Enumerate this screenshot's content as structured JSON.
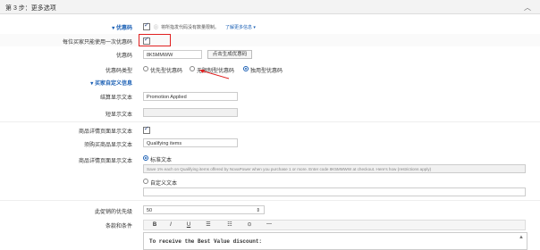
{
  "header": {
    "title": "第 3 步：更多选项"
  },
  "coupon_section": {
    "label": "优惠码",
    "note": "将所指发代码没有数量限制。",
    "link": "了解更多信息"
  },
  "once_per_buyer": {
    "label": "每位买家只能使用一次优惠码"
  },
  "code": {
    "label": "优惠码",
    "value": "8K5MMWW",
    "generate_button": "点击生成优惠码"
  },
  "code_type": {
    "label": "优惠码类型",
    "options": [
      "优先型优惠码",
      "无限制型优惠码",
      "独用型优惠码"
    ],
    "selected": 2
  },
  "custom_info": {
    "label": "买家自定义信息"
  },
  "checkout_text": {
    "label": "结算显示文本",
    "value": "Promotion Applied"
  },
  "short_text": {
    "label": "短显示文本",
    "value": ""
  },
  "detail_checkbox": {
    "label": "商品详情页面显示文本"
  },
  "purchase_text": {
    "label": "须购买商品显示文本",
    "value": "Qualifying items"
  },
  "detail_text": {
    "label": "商品详情页面显示文本",
    "standard_label": "标准文本",
    "standard_text": "Save 1% each on Qualifying items offered by NovaPower when you purchase 1 or more. Enter code 8K5MMWW at checkout. Here's how (restrictions apply)",
    "custom_label": "自定义文本"
  },
  "priority": {
    "label": "此促销的优先级",
    "value": "50"
  },
  "terms": {
    "label": "条款和条件",
    "editor_text": "To receive the Best Value discount:"
  },
  "toolbar": {
    "bold": "B",
    "italic": "I",
    "underline": "U",
    "list1": "☰",
    "list2": "☷",
    "circle": "⊙",
    "dash": "—"
  },
  "colors": {
    "link_blue": "#1a5fb4",
    "highlight_red": "#e02020"
  }
}
